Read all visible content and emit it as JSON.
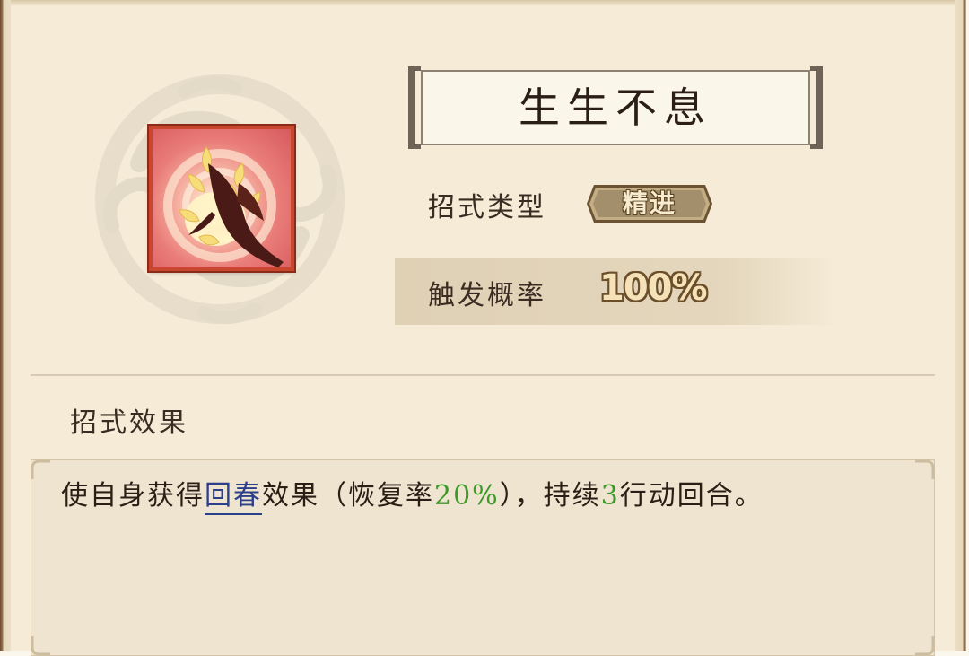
{
  "skill": {
    "title": "生生不息",
    "icon": "skill-leaf-flame-icon",
    "type_label": "招式类型",
    "type_value": "精进",
    "rate_label": "触发概率",
    "rate_value": "100%"
  },
  "effect": {
    "heading": "招式效果",
    "part1": "使自身获得",
    "link": "回春",
    "part2": "效果（恢复率",
    "value1": "20%",
    "part3": "），持续",
    "value2": "3",
    "part4": "行动回合。"
  },
  "colors": {
    "highlight_link": "#2b3f8a",
    "highlight_value": "#3f9a2c",
    "badge_fill": "#a38f6c",
    "icon_border": "#c9472e"
  }
}
